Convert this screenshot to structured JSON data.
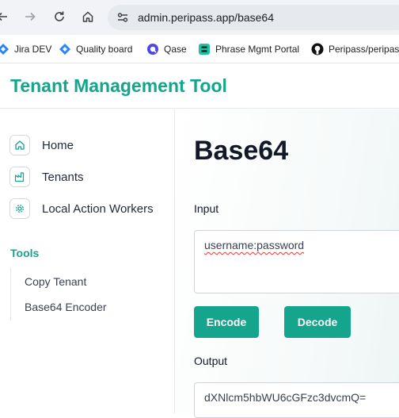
{
  "browser": {
    "url": "admin.peripass.app/base64",
    "bookmarks": [
      {
        "label": "Jira DEV",
        "icon": "jira-icon"
      },
      {
        "label": "Quality board",
        "icon": "jira-icon"
      },
      {
        "label": "Qase",
        "icon": "qase-icon"
      },
      {
        "label": "Phrase Mgmt Portal",
        "icon": "phrase-icon"
      },
      {
        "label": "Peripass/peripass",
        "icon": "github-icon"
      }
    ]
  },
  "app": {
    "title": "Tenant Management Tool"
  },
  "sidebar": {
    "items": [
      {
        "label": "Home",
        "icon": "home-icon"
      },
      {
        "label": "Tenants",
        "icon": "factory-icon"
      },
      {
        "label": "Local Action Workers",
        "icon": "gear-icon"
      }
    ],
    "tools_heading": "Tools",
    "tools": [
      {
        "label": "Copy Tenant"
      },
      {
        "label": "Base64 Encoder"
      }
    ]
  },
  "main": {
    "title": "Base64",
    "input_label": "Input",
    "input_value": "username:password",
    "encode_label": "Encode",
    "decode_label": "Decode",
    "output_label": "Output",
    "output_value": "dXNlcm5hbWU6cGFzc3dvcmQ="
  },
  "colors": {
    "accent": "#14a58c",
    "title_text": "#111827"
  }
}
